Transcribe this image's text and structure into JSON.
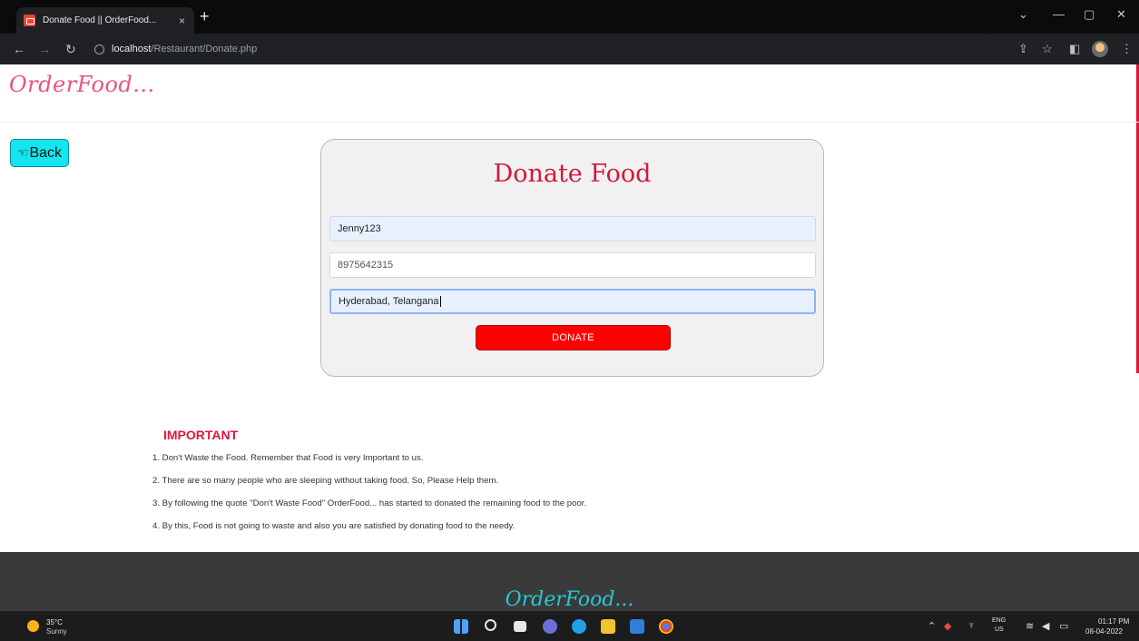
{
  "browser": {
    "tab_title": "Donate Food || OrderFood...",
    "tab_close": "×",
    "new_tab": "+",
    "url_host": "localhost",
    "url_path": "/Restaurant/Donate.php"
  },
  "header": {
    "logo": "OrderFood..."
  },
  "back_button": {
    "label": "Back"
  },
  "form": {
    "title": "Donate Food",
    "username_value": "Jenny123",
    "phone_value": "8975642315",
    "address_value": "Hyderabad, Telangana",
    "submit_label": "DONATE"
  },
  "important": {
    "title": "IMPORTANT",
    "items": [
      "1. Don't Waste the Food. Remember that Food is very Important to us.",
      "2. There are so many people who are sleeping without taking food. So, Please Help them.",
      "3. By following the quote \"Don't Waste Food\" OrderFood... has started to donated the remaining food to the poor.",
      "4. By this, Food is not going to waste and also you are satisfied by donating food to the needy."
    ]
  },
  "footer": {
    "logo": "OrderFood..."
  },
  "taskbar": {
    "weather_temp": "35°C",
    "weather_desc": "Sunny",
    "lang_line1": "ENG",
    "lang_line2": "US",
    "time": "01:17 PM",
    "date": "08-04-2022"
  },
  "colors": {
    "accent_red": "#e0163c",
    "donate_button": "#ff0000",
    "back_button": "#13e6ee",
    "footer_bg": "#3a3a3a"
  }
}
